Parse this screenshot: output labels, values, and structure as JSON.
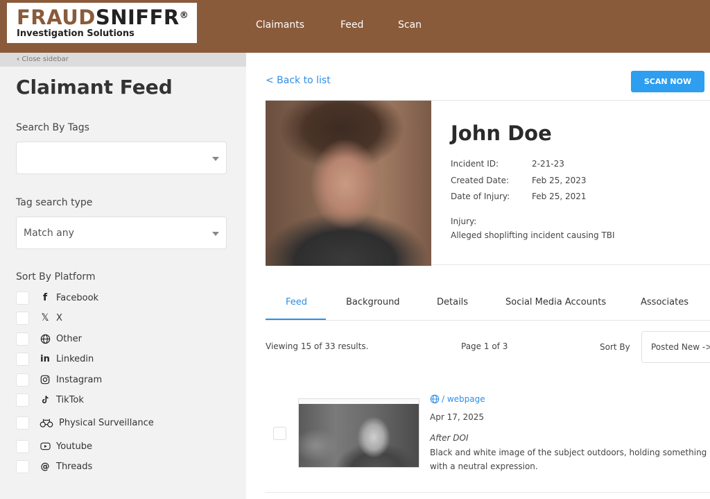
{
  "header": {
    "logo_main_a": "FRA",
    "logo_main_b": "UD",
    "logo_main_c": "SNIFFR",
    "logo_reg": "®",
    "logo_sub": "Investigation Solutions",
    "nav": [
      "Claimants",
      "Feed",
      "Scan"
    ]
  },
  "sidebar": {
    "close_label": "Close sidebar",
    "title": "Claimant Feed",
    "search_tags_label": "Search By Tags",
    "search_tags_value": "",
    "tag_type_label": "Tag search type",
    "tag_type_value": "Match any",
    "platform_label": "Sort By Platform",
    "platforms": [
      {
        "label": "Facebook",
        "icon": "facebook-icon"
      },
      {
        "label": "X",
        "icon": "x-icon"
      },
      {
        "label": "Other",
        "icon": "globe-icon"
      },
      {
        "label": "Linkedin",
        "icon": "linkedin-icon"
      },
      {
        "label": "Instagram",
        "icon": "instagram-icon"
      },
      {
        "label": "TikTok",
        "icon": "tiktok-icon"
      },
      {
        "label": "Physical Surveillance",
        "icon": "binoculars-icon"
      },
      {
        "label": "Youtube",
        "icon": "youtube-icon"
      },
      {
        "label": "Threads",
        "icon": "threads-icon"
      }
    ]
  },
  "main": {
    "back_label": "< Back to list",
    "scan_label": "SCAN NOW",
    "claimant": {
      "name": "John Doe",
      "incident_id_label": "Incident ID:",
      "incident_id": "2-21-23",
      "created_label": "Created Date:",
      "created": "Feb 25, 2023",
      "doi_label": "Date of Injury:",
      "doi": "Feb 25, 2021",
      "injury_label": "Injury:",
      "injury": "Alleged shoplifting incident causing TBI"
    },
    "tabs": [
      "Feed",
      "Background",
      "Details",
      "Social Media Accounts",
      "Associates"
    ],
    "viewing": "Viewing 15 of 33 results.",
    "page": "Page 1 of 3",
    "sort_label": "Sort By",
    "sort_value": "Posted New ->",
    "item": {
      "source": "/ webpage",
      "date": "Apr 17, 2025",
      "tag": "After DOI",
      "description": "Black and white image of the subject outdoors, holding something with a neutral expression."
    }
  },
  "colors": {
    "header_brown": "#8a5b3a",
    "accent_blue": "#2d8ee6",
    "scan_button": "#2d9ef0"
  }
}
